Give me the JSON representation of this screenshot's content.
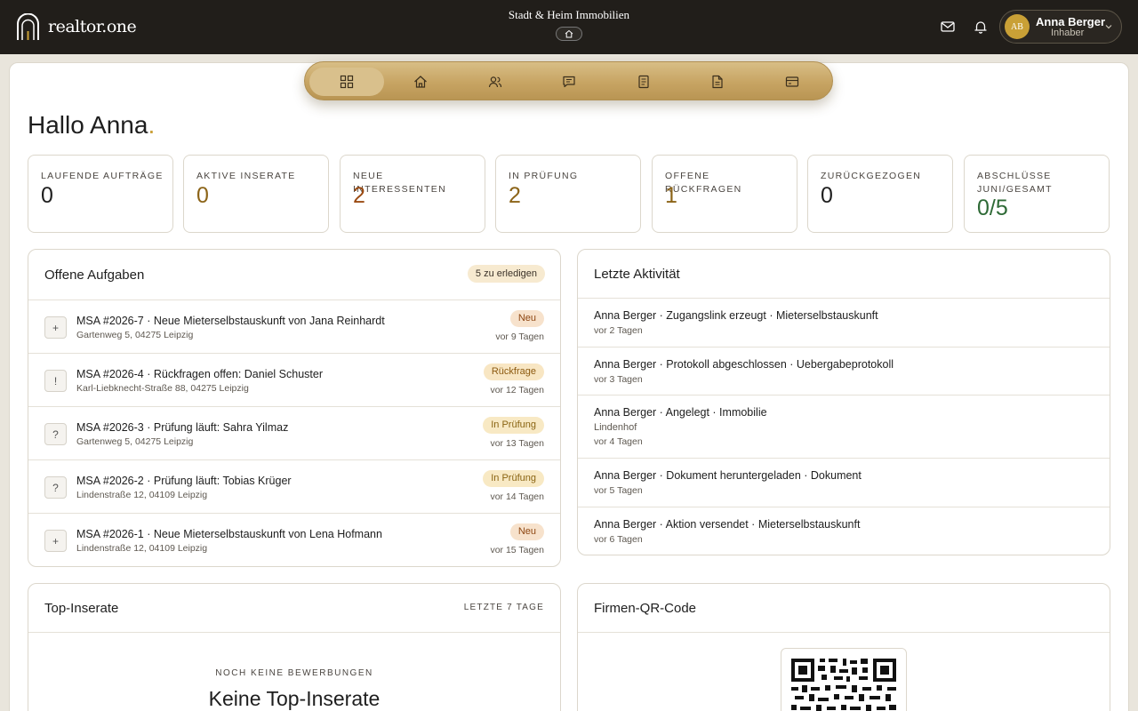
{
  "header": {
    "brand": "realtor.one",
    "company": "Stadt & Heim Immobilien",
    "user": {
      "initials": "AB",
      "name": "Anna Berger",
      "role": "Inhaber"
    }
  },
  "nav": {
    "items": [
      {
        "icon": "dashboard-icon",
        "active": true
      },
      {
        "icon": "home-icon",
        "active": false
      },
      {
        "icon": "users-icon",
        "active": false
      },
      {
        "icon": "chat-icon",
        "active": false
      },
      {
        "icon": "document-list-icon",
        "active": false
      },
      {
        "icon": "document-icon",
        "active": false
      },
      {
        "icon": "card-icon",
        "active": false
      }
    ]
  },
  "greeting": {
    "text": "Hallo Anna",
    "dot": "."
  },
  "stats": [
    {
      "label": "LAUFENDE AUFTRÄGE",
      "value": "0",
      "color": "#1e1e1e"
    },
    {
      "label": "AKTIVE INSERATE",
      "value": "0",
      "color": "#8c6418"
    },
    {
      "label": "NEUE INTERESSENTEN",
      "value": "2",
      "color": "#9a4a12"
    },
    {
      "label": "IN PRÜFUNG",
      "value": "2",
      "color": "#8c6418"
    },
    {
      "label": "OFFENE RÜCKFRAGEN",
      "value": "1",
      "color": "#8c6418"
    },
    {
      "label": "ZURÜCKGEZOGEN",
      "value": "0",
      "color": "#1e1e1e"
    },
    {
      "label": "ABSCHLÜSSE JUNI/GESAMT",
      "value": "0/5",
      "color": "#2e6a36"
    }
  ],
  "tasks": {
    "title": "Offene Aufgaben",
    "count_label": "5 zu erledigen",
    "items": [
      {
        "symbol": "+",
        "title": "MSA #2026-7 · Neue Mieterselbstauskunft von Jana Reinhardt",
        "address": "Gartenweg 5, 04275 Leipzig",
        "badge": "Neu",
        "time": "vor 9 Tagen"
      },
      {
        "symbol": "!",
        "title": "MSA #2026-4 · Rückfragen offen: Daniel Schuster",
        "address": "Karl-Liebknecht-Straße 88, 04275 Leipzig",
        "badge": "Rückfrage",
        "time": "vor 12 Tagen"
      },
      {
        "symbol": "?",
        "title": "MSA #2026-3 · Prüfung läuft: Sahra Yilmaz",
        "address": "Gartenweg 5, 04275 Leipzig",
        "badge": "In Prüfung",
        "time": "vor 13 Tagen"
      },
      {
        "symbol": "?",
        "title": "MSA #2026-2 · Prüfung läuft: Tobias Krüger",
        "address": "Lindenstraße 12, 04109 Leipzig",
        "badge": "In Prüfung",
        "time": "vor 14 Tagen"
      },
      {
        "symbol": "+",
        "title": "MSA #2026-1 · Neue Mieterselbstauskunft von Lena Hofmann",
        "address": "Lindenstraße 12, 04109 Leipzig",
        "badge": "Neu",
        "time": "vor 15 Tagen"
      }
    ]
  },
  "activity": {
    "title": "Letzte Aktivität",
    "items": [
      {
        "text": "Anna Berger · Zugangslink erzeugt · Mieterselbstauskunft",
        "extra": "",
        "time": "vor 2 Tagen"
      },
      {
        "text": "Anna Berger · Protokoll abgeschlossen · Uebergabeprotokoll",
        "extra": "",
        "time": "vor 3 Tagen"
      },
      {
        "text": "Anna Berger · Angelegt · Immobilie",
        "extra": "Lindenhof",
        "time": "vor 4 Tagen"
      },
      {
        "text": "Anna Berger · Dokument heruntergeladen · Dokument",
        "extra": "",
        "time": "vor 5 Tagen"
      },
      {
        "text": "Anna Berger · Aktion versendet · Mieterselbstauskunft",
        "extra": "",
        "time": "vor 6 Tagen"
      }
    ]
  },
  "top_listings": {
    "title": "Top-Inserate",
    "range": "LETZTE 7 TAGE",
    "empty_kicker": "NOCH KEINE BEWERBUNGEN",
    "empty_title": "Keine Top-Inserate"
  },
  "qr": {
    "title": "Firmen-QR-Code"
  }
}
